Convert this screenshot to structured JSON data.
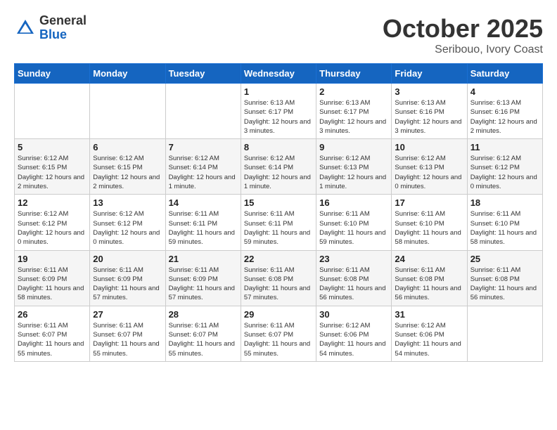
{
  "header": {
    "logo_general": "General",
    "logo_blue": "Blue",
    "month": "October 2025",
    "location": "Seribouo, Ivory Coast"
  },
  "weekdays": [
    "Sunday",
    "Monday",
    "Tuesday",
    "Wednesday",
    "Thursday",
    "Friday",
    "Saturday"
  ],
  "weeks": [
    [
      null,
      null,
      null,
      {
        "day": 1,
        "sunrise": "6:13 AM",
        "sunset": "6:17 PM",
        "daylight": "12 hours and 3 minutes."
      },
      {
        "day": 2,
        "sunrise": "6:13 AM",
        "sunset": "6:17 PM",
        "daylight": "12 hours and 3 minutes."
      },
      {
        "day": 3,
        "sunrise": "6:13 AM",
        "sunset": "6:16 PM",
        "daylight": "12 hours and 3 minutes."
      },
      {
        "day": 4,
        "sunrise": "6:13 AM",
        "sunset": "6:16 PM",
        "daylight": "12 hours and 2 minutes."
      }
    ],
    [
      {
        "day": 5,
        "sunrise": "6:12 AM",
        "sunset": "6:15 PM",
        "daylight": "12 hours and 2 minutes."
      },
      {
        "day": 6,
        "sunrise": "6:12 AM",
        "sunset": "6:15 PM",
        "daylight": "12 hours and 2 minutes."
      },
      {
        "day": 7,
        "sunrise": "6:12 AM",
        "sunset": "6:14 PM",
        "daylight": "12 hours and 1 minute."
      },
      {
        "day": 8,
        "sunrise": "6:12 AM",
        "sunset": "6:14 PM",
        "daylight": "12 hours and 1 minute."
      },
      {
        "day": 9,
        "sunrise": "6:12 AM",
        "sunset": "6:13 PM",
        "daylight": "12 hours and 1 minute."
      },
      {
        "day": 10,
        "sunrise": "6:12 AM",
        "sunset": "6:13 PM",
        "daylight": "12 hours and 0 minutes."
      },
      {
        "day": 11,
        "sunrise": "6:12 AM",
        "sunset": "6:12 PM",
        "daylight": "12 hours and 0 minutes."
      }
    ],
    [
      {
        "day": 12,
        "sunrise": "6:12 AM",
        "sunset": "6:12 PM",
        "daylight": "12 hours and 0 minutes."
      },
      {
        "day": 13,
        "sunrise": "6:12 AM",
        "sunset": "6:12 PM",
        "daylight": "12 hours and 0 minutes."
      },
      {
        "day": 14,
        "sunrise": "6:11 AM",
        "sunset": "6:11 PM",
        "daylight": "11 hours and 59 minutes."
      },
      {
        "day": 15,
        "sunrise": "6:11 AM",
        "sunset": "6:11 PM",
        "daylight": "11 hours and 59 minutes."
      },
      {
        "day": 16,
        "sunrise": "6:11 AM",
        "sunset": "6:10 PM",
        "daylight": "11 hours and 59 minutes."
      },
      {
        "day": 17,
        "sunrise": "6:11 AM",
        "sunset": "6:10 PM",
        "daylight": "11 hours and 58 minutes."
      },
      {
        "day": 18,
        "sunrise": "6:11 AM",
        "sunset": "6:10 PM",
        "daylight": "11 hours and 58 minutes."
      }
    ],
    [
      {
        "day": 19,
        "sunrise": "6:11 AM",
        "sunset": "6:09 PM",
        "daylight": "11 hours and 58 minutes."
      },
      {
        "day": 20,
        "sunrise": "6:11 AM",
        "sunset": "6:09 PM",
        "daylight": "11 hours and 57 minutes."
      },
      {
        "day": 21,
        "sunrise": "6:11 AM",
        "sunset": "6:09 PM",
        "daylight": "11 hours and 57 minutes."
      },
      {
        "day": 22,
        "sunrise": "6:11 AM",
        "sunset": "6:08 PM",
        "daylight": "11 hours and 57 minutes."
      },
      {
        "day": 23,
        "sunrise": "6:11 AM",
        "sunset": "6:08 PM",
        "daylight": "11 hours and 56 minutes."
      },
      {
        "day": 24,
        "sunrise": "6:11 AM",
        "sunset": "6:08 PM",
        "daylight": "11 hours and 56 minutes."
      },
      {
        "day": 25,
        "sunrise": "6:11 AM",
        "sunset": "6:08 PM",
        "daylight": "11 hours and 56 minutes."
      }
    ],
    [
      {
        "day": 26,
        "sunrise": "6:11 AM",
        "sunset": "6:07 PM",
        "daylight": "11 hours and 55 minutes."
      },
      {
        "day": 27,
        "sunrise": "6:11 AM",
        "sunset": "6:07 PM",
        "daylight": "11 hours and 55 minutes."
      },
      {
        "day": 28,
        "sunrise": "6:11 AM",
        "sunset": "6:07 PM",
        "daylight": "11 hours and 55 minutes."
      },
      {
        "day": 29,
        "sunrise": "6:11 AM",
        "sunset": "6:07 PM",
        "daylight": "11 hours and 55 minutes."
      },
      {
        "day": 30,
        "sunrise": "6:12 AM",
        "sunset": "6:06 PM",
        "daylight": "11 hours and 54 minutes."
      },
      {
        "day": 31,
        "sunrise": "6:12 AM",
        "sunset": "6:06 PM",
        "daylight": "11 hours and 54 minutes."
      },
      null
    ]
  ]
}
